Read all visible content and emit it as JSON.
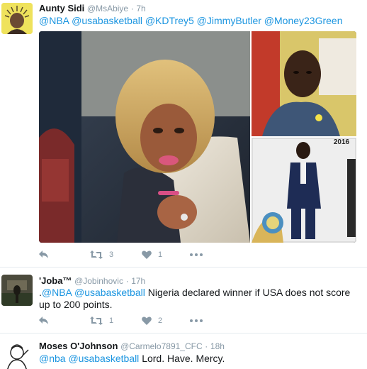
{
  "tweets": [
    {
      "name": "Aunty Sidi",
      "handle": "@MsAbiye",
      "sep": "·",
      "time": "7h",
      "mentions": [
        "@NBA",
        "@usabasketball",
        "@KDTrey5",
        "@JimmyButler",
        "@Money23Green"
      ],
      "text": "",
      "retweets": "3",
      "likes": "1",
      "media_year_label": "2016"
    },
    {
      "name": "'Joba™",
      "handle": "@Jobinhovic",
      "sep": "·",
      "time": "17h",
      "prefix": ".",
      "mentions": [
        "@NBA",
        "@usabasketball"
      ],
      "text": "Nigeria declared winner if USA does not score up to 200 points.",
      "retweets": "1",
      "likes": "2"
    },
    {
      "name": "Moses O'Johnson",
      "handle": "@Carmelo7891_CFC",
      "sep": "·",
      "time": "18h",
      "mentions": [
        "@nba",
        "@usabasketball"
      ],
      "text": "Lord. Have. Mercy."
    }
  ],
  "icons": {
    "reply": "reply-icon",
    "retweet": "retweet-icon",
    "like": "heart-icon",
    "more": "more-icon"
  },
  "colors": {
    "mention": "#1b95e0",
    "meta": "#8899a6",
    "divider": "#e6ecf0"
  }
}
